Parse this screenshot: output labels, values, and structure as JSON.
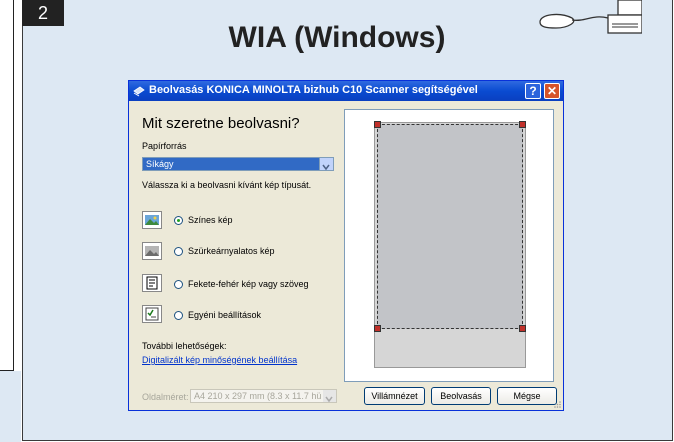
{
  "step": "2",
  "page_title": "WIA (Windows)",
  "dialog": {
    "title": "Beolvasás KONICA MINOLTA bizhub C10 Scanner segítségével",
    "help_button": "?",
    "close_button": "✕",
    "heading": "Mit szeretne beolvasni?",
    "paper_source_label": "Papírforrás",
    "paper_source_value": "Síkágy",
    "picture_type_prompt": "Válassza ki a beolvasni kívánt kép típusát.",
    "options": [
      {
        "label": "Színes kép",
        "selected": true,
        "icon": "color-picture-icon"
      },
      {
        "label": "Szürkeárnyalatos kép",
        "selected": false,
        "icon": "grayscale-picture-icon"
      },
      {
        "label": "Fekete-fehér kép vagy szöveg",
        "selected": false,
        "icon": "black-white-text-icon"
      },
      {
        "label": "Egyéni beállítások",
        "selected": false,
        "icon": "custom-settings-icon"
      }
    ],
    "more_options_label": "További lehetőségek:",
    "adjust_quality_link": "Digitalizált kép minőségének beállítása",
    "page_size_label": "Oldalméret:",
    "page_size_value": "A4 210 x 297 mm (8.3 x 11.7 hü",
    "buttons": {
      "preview": "Villámnézet",
      "scan": "Beolvasás",
      "cancel": "Mégse"
    }
  },
  "colors": {
    "panel_background": "#dde8f3",
    "titlebar": "#0a4bd1",
    "link": "#0033cc"
  }
}
